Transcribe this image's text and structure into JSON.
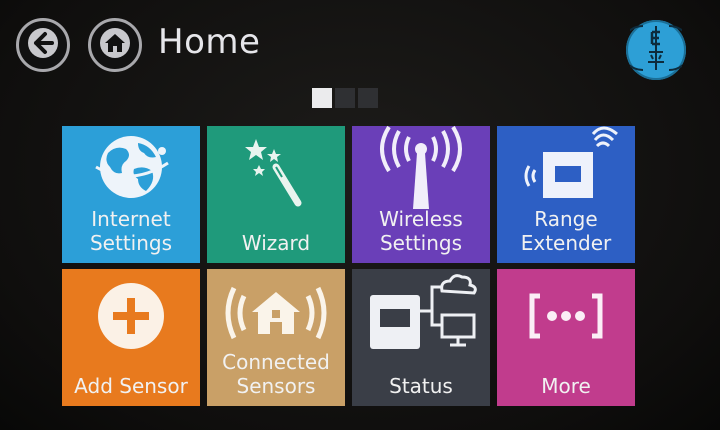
{
  "header": {
    "title": "Home"
  },
  "pager": {
    "pages": 3,
    "current": 1
  },
  "tiles": [
    {
      "label_line1": "Internet",
      "label_line2": "Settings",
      "color": "#2c9fd8",
      "icon": "globe-icon"
    },
    {
      "label_line1": "",
      "label_line2": "Wizard",
      "color": "#1f9a7b",
      "icon": "magic-wand-icon"
    },
    {
      "label_line1": "Wireless",
      "label_line2": "Settings",
      "color": "#6a3fb8",
      "icon": "antenna-icon"
    },
    {
      "label_line1": "Range",
      "label_line2": "Extender",
      "color": "#2d5fc4",
      "icon": "range-extender-icon"
    },
    {
      "label_line1": "",
      "label_line2": "Add Sensor",
      "color": "#e87a1e",
      "icon": "plus-circle-icon"
    },
    {
      "label_line1": "Connected",
      "label_line2": "Sensors",
      "color": "#c9a067",
      "icon": "home-signal-icon"
    },
    {
      "label_line1": "",
      "label_line2": "Status",
      "color": "#3a3e47",
      "icon": "network-status-icon"
    },
    {
      "label_line1": "",
      "label_line2": "More",
      "color": "#c13c8d",
      "icon": "more-dots-icon"
    }
  ]
}
